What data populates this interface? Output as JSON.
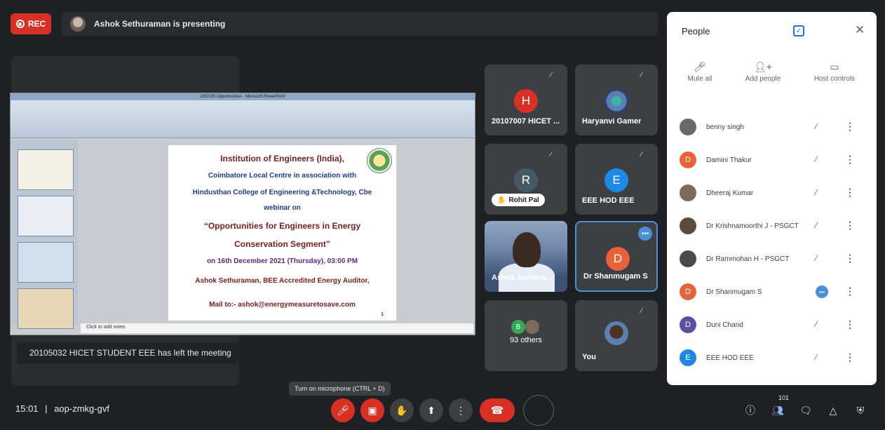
{
  "top": {
    "rec_label": "REC",
    "presenting_text": "Ashok Sethuraman is presenting"
  },
  "presentation": {
    "window_title": "UNCON Opportunities - Microsoft PowerPoint",
    "notes_placeholder": "Click to add notes",
    "slide_lines": [
      "Institution of Engineers (India),",
      "Coimbatore Local Centre in association with",
      "Hindusthan College of Engineering &Technology, Cbe",
      "webinar on",
      "“Opportunities for Engineers in Energy",
      "Conservation Segment”",
      "on 16th December 2021 (Thursday), 03:00 PM",
      "Ashok Sethuraman, BEE Accredited Energy Auditor,",
      "Mail to:- ashok@energymeasuretosave.com"
    ],
    "slide_page": "1"
  },
  "notification": "20105032 HICET STUDENT EEE has left the meeting",
  "tiles": [
    {
      "initial": "H",
      "name": "20107007 HICET ...",
      "color": "#d93025"
    },
    {
      "initial": "",
      "name": "Haryanvi Gamer",
      "color": "#5a7fb0"
    },
    {
      "initial": "R",
      "name": "Rohit Pal",
      "color": "#455a64"
    },
    {
      "initial": "E",
      "name": "EEE HOD EEE",
      "color": "#1e88e5"
    },
    {
      "initial": "",
      "name": "Ashok Sethura...",
      "color": "#6f86a8"
    },
    {
      "initial": "D",
      "name": "Dr Shanmugam S",
      "color": "#e8633a"
    },
    {
      "initial": "B",
      "name": "93 others",
      "color": "#34a853"
    },
    {
      "initial": "",
      "name": "You",
      "color": "#5a7fb0"
    }
  ],
  "bottom": {
    "time": "15:01",
    "separator": "|",
    "meeting_code": "aop-zmkg-gvf",
    "mic_tooltip": "Turn on microphone (CTRL + D)",
    "participant_count": "101"
  },
  "people_panel": {
    "title": "People",
    "actions": [
      {
        "label": "Mute all",
        "icon": "mic-off-icon"
      },
      {
        "label": "Add people",
        "icon": "add-person-icon"
      },
      {
        "label": "Host controls",
        "icon": "toggle-icon"
      }
    ],
    "participants": [
      {
        "name": "benny singh",
        "initial": "",
        "color": "#6a6a6a",
        "status": "muted"
      },
      {
        "name": "Damini Thakur",
        "initial": "D",
        "color": "#e8633a",
        "status": "muted"
      },
      {
        "name": "Dheeraj Kumar",
        "initial": "",
        "color": "#7b6a5e",
        "status": "muted"
      },
      {
        "name": "Dr Krishnamoorthi J - PSGCT",
        "initial": "",
        "color": "#5b4a3e",
        "status": "muted"
      },
      {
        "name": "Dr Rammohan H - PSGCT",
        "initial": "",
        "color": "#4a4a4a",
        "status": "muted"
      },
      {
        "name": "Dr Shanmugam S",
        "initial": "D",
        "color": "#e8633a",
        "status": "speaking"
      },
      {
        "name": "Duni Chand",
        "initial": "D",
        "color": "#5c4fa6",
        "status": "muted"
      },
      {
        "name": "EEE HOD EEE",
        "initial": "E",
        "color": "#1e88e5",
        "status": "muted"
      }
    ]
  }
}
